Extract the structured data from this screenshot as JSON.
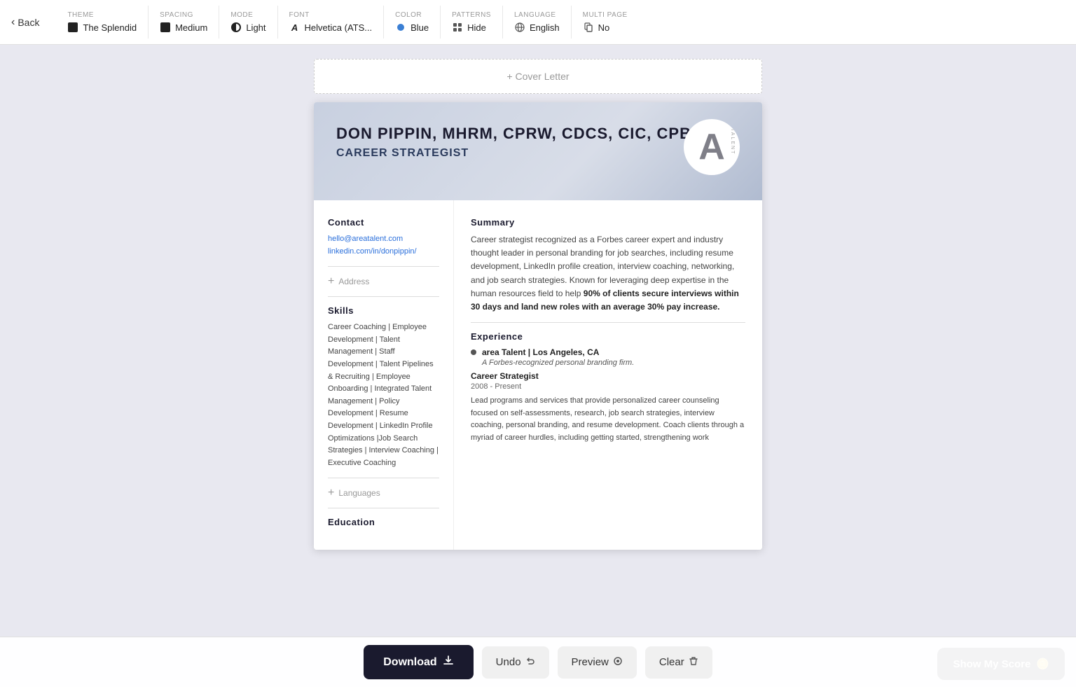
{
  "topbar": {
    "back_label": "Back",
    "options": [
      {
        "id": "theme",
        "label": "THEME",
        "value": "The Splendid",
        "icon_type": "square"
      },
      {
        "id": "spacing",
        "label": "SPACING",
        "value": "Medium",
        "icon_type": "square"
      },
      {
        "id": "mode",
        "label": "MODE",
        "value": "Light",
        "icon_type": "half-circle"
      },
      {
        "id": "font",
        "label": "FONT",
        "value": "Helvetica (ATS...",
        "icon_type": "font"
      },
      {
        "id": "color",
        "label": "COLOR",
        "value": "Blue",
        "icon_type": "dot"
      },
      {
        "id": "patterns",
        "label": "PATTERNS",
        "value": "Hide",
        "icon_type": "grid"
      },
      {
        "id": "language",
        "label": "LANGUAGE",
        "value": "English",
        "icon_type": "globe"
      },
      {
        "id": "multipage",
        "label": "MULTI PAGE",
        "value": "No",
        "icon_type": "multipage"
      }
    ]
  },
  "cover_letter": {
    "label": "+ Cover Letter"
  },
  "resume": {
    "name": "DON PIPPIN, MHRM, CPRW, CDCS, CIC, CPBS",
    "title": "CAREER STRATEGIST",
    "logo_letter": "A",
    "contact": {
      "label": "Contact",
      "email": "hello@areatalent.com",
      "linkedin": "linkedin.com/in/donpippin/"
    },
    "address": {
      "label": "Address"
    },
    "skills": {
      "label": "Skills",
      "text": "Career Coaching | Employee Development | Talent Management | Staff Development | Talent Pipelines & Recruiting | Employee Onboarding | Integrated Talent Management | Policy Development | Resume Development | LinkedIn Profile Optimizations |Job Search Strategies | Interview Coaching | Executive Coaching"
    },
    "languages": {
      "label": "Languages"
    },
    "education": {
      "label": "Education"
    },
    "summary": {
      "label": "Summary",
      "text_normal": "Career strategist recognized as a Forbes career expert and industry thought leader in personal branding for job searches, including resume development, LinkedIn profile creation, interview coaching, networking, and job search strategies. Known for leveraging deep expertise in the human resources field to help ",
      "text_bold": "90% of clients secure interviews within 30 days and land new roles with an average 30% pay increase.",
      "text_after": ""
    },
    "experience": {
      "label": "Experience",
      "jobs": [
        {
          "company": "area Talent | Los Angeles, CA",
          "company_desc": "A Forbes-recognized personal branding firm.",
          "role": "Career Strategist",
          "dates": "2008 - Present",
          "description": "Lead programs and services that provide personalized career counseling focused on self-assessments, research, job search strategies, interview coaching, personal branding, and resume development. Coach clients through a myriad of career hurdles, including getting started, strengthening work"
        }
      ]
    }
  },
  "toolbar": {
    "download_label": "Download",
    "undo_label": "Undo",
    "preview_label": "Preview",
    "clear_label": "Clear",
    "show_score_label": "Show My Score"
  }
}
